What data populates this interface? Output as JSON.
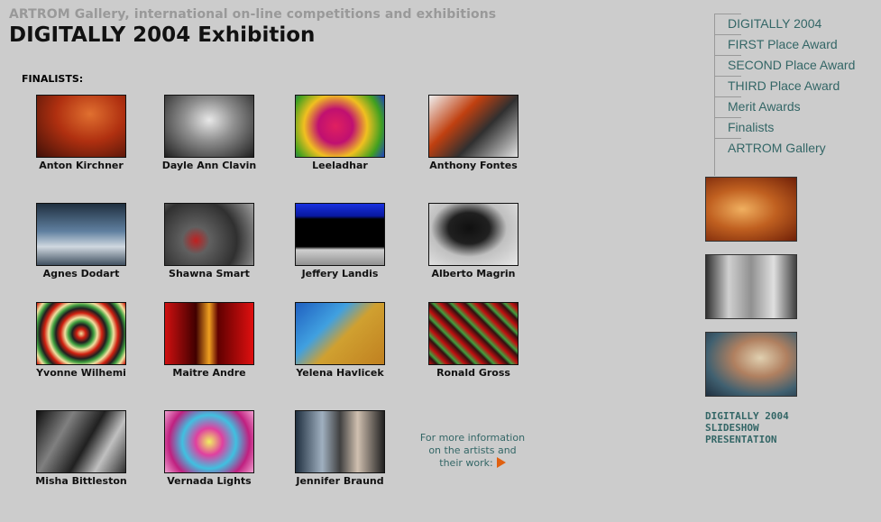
{
  "header": {
    "subtitle": "ARTROM Gallery, international on-line competitions and exhibitions",
    "title": "DIGITALLY 2004 Exhibition"
  },
  "finalists_label": "FINALISTS:",
  "finalists": [
    {
      "name": "Anton Kirchner"
    },
    {
      "name": "Dayle Ann Clavin"
    },
    {
      "name": "Leeladhar"
    },
    {
      "name": "Anthony Fontes"
    },
    {
      "name": "Agnes Dodart"
    },
    {
      "name": "Shawna Smart"
    },
    {
      "name": "Jeffery Landis"
    },
    {
      "name": "Alberto Magrin"
    },
    {
      "name": "Yvonne Wilhemi"
    },
    {
      "name": "Maitre Andre"
    },
    {
      "name": "Yelena Havlicek"
    },
    {
      "name": "Ronald Gross"
    },
    {
      "name": "Misha Bittleston"
    },
    {
      "name": "Vernada Lights"
    },
    {
      "name": "Jennifer Braund"
    }
  ],
  "more_info": {
    "line1": "For more information",
    "line2": "on the artists and",
    "line3": "their work:"
  },
  "nav": {
    "items": [
      {
        "label": "DIGITALLY 2004"
      },
      {
        "label": "FIRST Place Award"
      },
      {
        "label": "SECOND Place Award"
      },
      {
        "label": "THIRD Place Award"
      },
      {
        "label": "Merit Awards"
      },
      {
        "label": "Finalists"
      },
      {
        "label": "ARTROM Gallery"
      }
    ]
  },
  "slideshow": {
    "line1": "DIGITALLY 2004",
    "line2": "SLIDESHOW",
    "line3": "PRESENTATION"
  },
  "colors": {
    "background": "#cccccc",
    "link": "#336666",
    "subtitle": "#999999",
    "arrow": "#e06010"
  }
}
